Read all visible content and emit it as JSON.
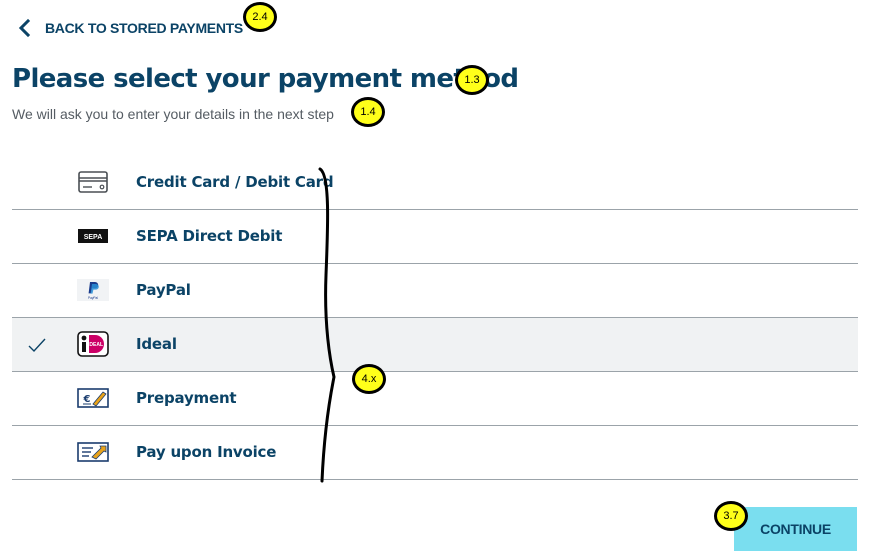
{
  "back": {
    "label": "BACK TO STORED PAYMENTS",
    "icon": "chevron-left-icon"
  },
  "title": "Please select your payment method",
  "subtitle": "We will ask you to enter your details in the next step",
  "methods": [
    {
      "label": "Credit Card / Debit Card",
      "icon": "credit-card-icon",
      "selected": false
    },
    {
      "label": "SEPA Direct Debit",
      "icon": "sepa-logo-icon",
      "selected": false
    },
    {
      "label": "PayPal",
      "icon": "paypal-logo-icon",
      "selected": false
    },
    {
      "label": "Ideal",
      "icon": "ideal-logo-icon",
      "selected": true
    },
    {
      "label": "Prepayment",
      "icon": "prepayment-icon",
      "selected": false
    },
    {
      "label": "Pay upon Invoice",
      "icon": "invoice-icon",
      "selected": false
    }
  ],
  "continue_label": "CONTINUE",
  "icon_text": {
    "sepa": "SEPA",
    "ideal": "iDEAL",
    "paypal": "PayPal"
  },
  "annotations": [
    "2.4",
    "1.3",
    "1.4",
    "4.x",
    "3.7"
  ],
  "colors": {
    "text": "#0b4366",
    "button": "#7adeef",
    "annotation": "#ffff1a",
    "selected_row": "#f0f2f3"
  }
}
